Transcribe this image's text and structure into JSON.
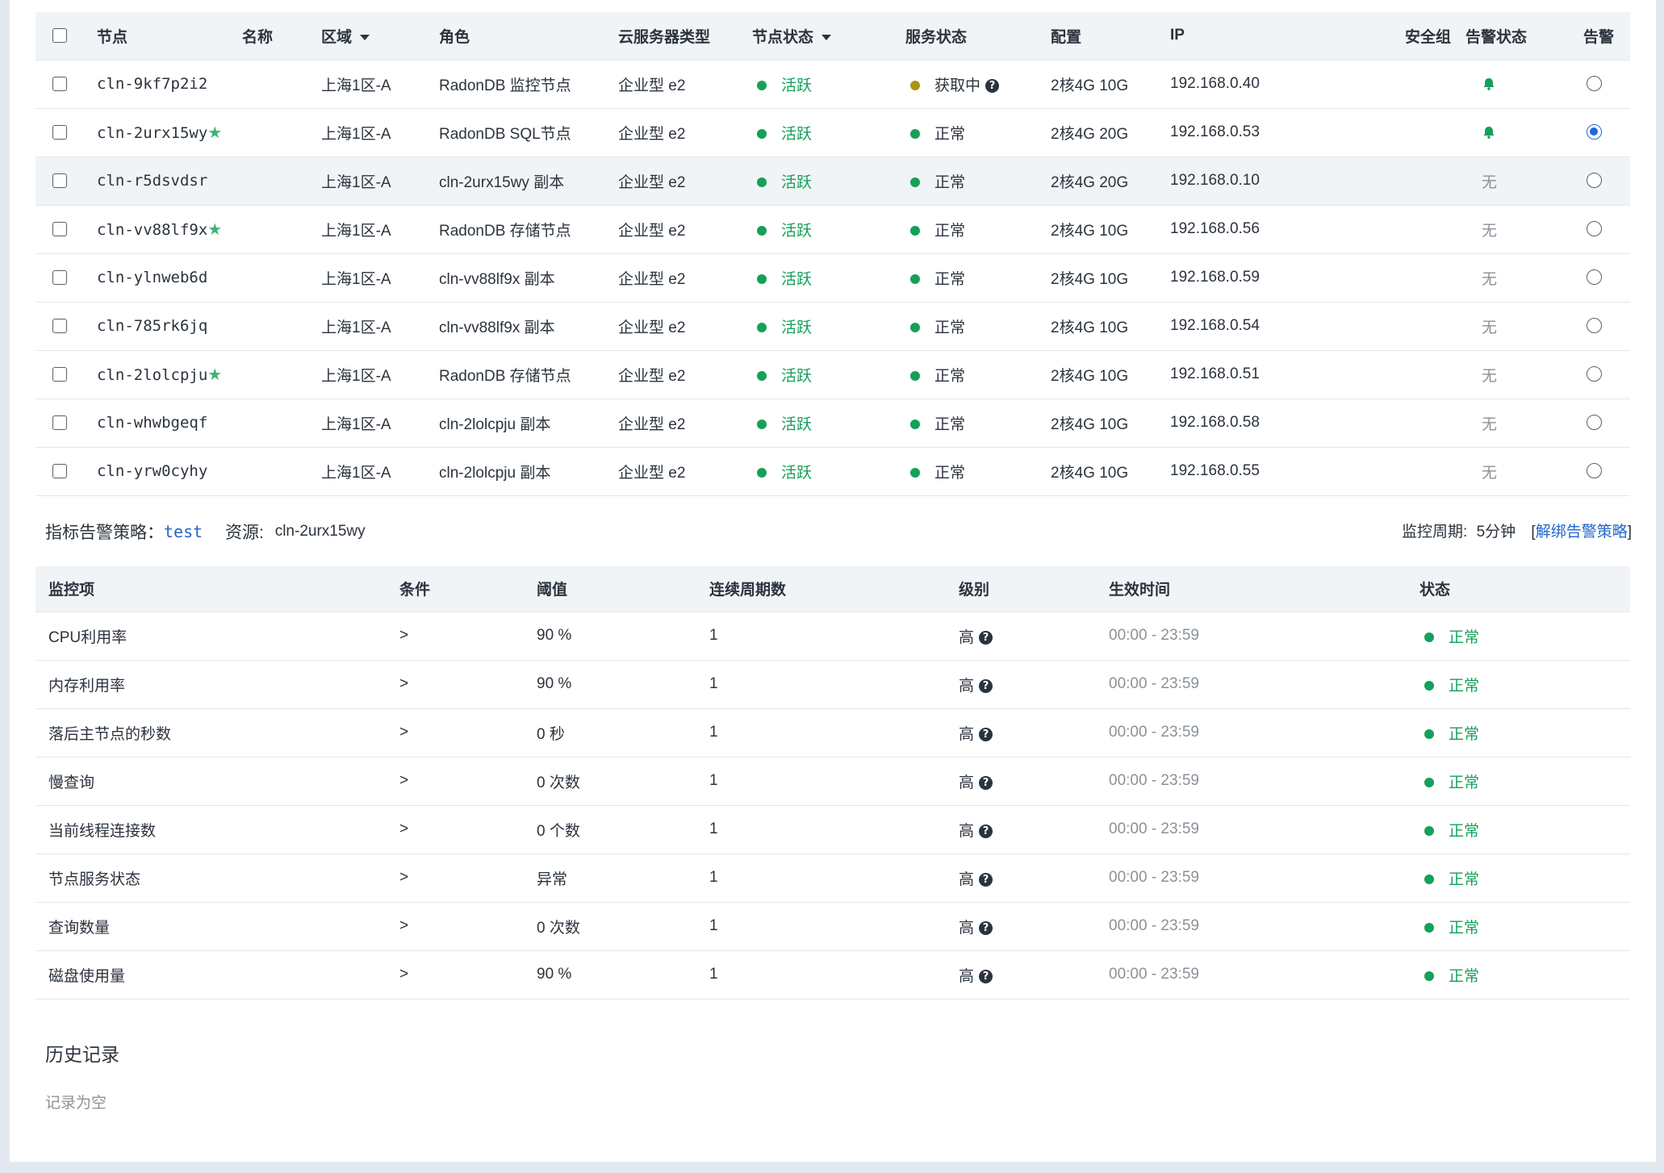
{
  "node_table": {
    "headers": {
      "node": "节点",
      "name": "名称",
      "zone": "区域",
      "role": "角色",
      "instance_type": "云服务器类型",
      "node_status": "节点状态",
      "service_status": "服务状态",
      "config": "配置",
      "ip": "IP",
      "security_group": "安全组",
      "alarm_status": "告警状态",
      "alarm": "告警"
    },
    "rows": [
      {
        "node": "cln-9kf7p2i2",
        "star": "",
        "zone": "上海1区-A",
        "role": "RadonDB 监控节点",
        "type": "企业型 e2",
        "node_status": "活跃",
        "service_status": "获取中",
        "service_color": "olive",
        "service_help": true,
        "config": "2核4G 10G",
        "ip": "192.168.0.40",
        "alarm_status": "bell",
        "alarm_selected": false
      },
      {
        "node": "cln-2urx15wy",
        "star": "★",
        "zone": "上海1区-A",
        "role": "RadonDB SQL节点",
        "type": "企业型 e2",
        "node_status": "活跃",
        "service_status": "正常",
        "service_color": "green",
        "service_help": false,
        "config": "2核4G 20G",
        "ip": "192.168.0.53",
        "alarm_status": "bell",
        "alarm_selected": true
      },
      {
        "node": "cln-r5dsvdsr",
        "star": "",
        "zone": "上海1区-A",
        "role": "cln-2urx15wy 副本",
        "type": "企业型 e2",
        "node_status": "活跃",
        "service_status": "正常",
        "service_color": "green",
        "service_help": false,
        "config": "2核4G 20G",
        "ip": "192.168.0.10",
        "alarm_status": "无",
        "alarm_selected": false,
        "highlight": true
      },
      {
        "node": "cln-vv88lf9x",
        "star": "★",
        "zone": "上海1区-A",
        "role": "RadonDB 存储节点",
        "type": "企业型 e2",
        "node_status": "活跃",
        "service_status": "正常",
        "service_color": "green",
        "service_help": false,
        "config": "2核4G 10G",
        "ip": "192.168.0.56",
        "alarm_status": "无",
        "alarm_selected": false
      },
      {
        "node": "cln-ylnweb6d",
        "star": "",
        "zone": "上海1区-A",
        "role": "cln-vv88lf9x 副本",
        "type": "企业型 e2",
        "node_status": "活跃",
        "service_status": "正常",
        "service_color": "green",
        "service_help": false,
        "config": "2核4G 10G",
        "ip": "192.168.0.59",
        "alarm_status": "无",
        "alarm_selected": false
      },
      {
        "node": "cln-785rk6jq",
        "star": "",
        "zone": "上海1区-A",
        "role": "cln-vv88lf9x 副本",
        "type": "企业型 e2",
        "node_status": "活跃",
        "service_status": "正常",
        "service_color": "green",
        "service_help": false,
        "config": "2核4G 10G",
        "ip": "192.168.0.54",
        "alarm_status": "无",
        "alarm_selected": false
      },
      {
        "node": "cln-2lolcpju",
        "star": "★",
        "zone": "上海1区-A",
        "role": "RadonDB 存储节点",
        "type": "企业型 e2",
        "node_status": "活跃",
        "service_status": "正常",
        "service_color": "green",
        "service_help": false,
        "config": "2核4G 10G",
        "ip": "192.168.0.51",
        "alarm_status": "无",
        "alarm_selected": false
      },
      {
        "node": "cln-whwbgeqf",
        "star": "",
        "zone": "上海1区-A",
        "role": "cln-2lolcpju 副本",
        "type": "企业型 e2",
        "node_status": "活跃",
        "service_status": "正常",
        "service_color": "green",
        "service_help": false,
        "config": "2核4G 10G",
        "ip": "192.168.0.58",
        "alarm_status": "无",
        "alarm_selected": false
      },
      {
        "node": "cln-yrw0cyhy",
        "star": "",
        "zone": "上海1区-A",
        "role": "cln-2lolcpju 副本",
        "type": "企业型 e2",
        "node_status": "活跃",
        "service_status": "正常",
        "service_color": "green",
        "service_help": false,
        "config": "2核4G 10G",
        "ip": "192.168.0.55",
        "alarm_status": "无",
        "alarm_selected": false
      }
    ]
  },
  "policy": {
    "label": "指标告警策略：",
    "name": "test",
    "resource_label": "资源:",
    "resource": "cln-2urx15wy",
    "period_label": "监控周期:",
    "period": "5分钟",
    "bracket_open": "[",
    "unbind": "解绑告警策略",
    "bracket_close": "]"
  },
  "metric_table": {
    "headers": {
      "item": "监控项",
      "condition": "条件",
      "threshold": "阈值",
      "periods": "连续周期数",
      "level": "级别",
      "time": "生效时间",
      "status": "状态"
    },
    "rows": [
      {
        "item": "CPU利用率",
        "condition": ">",
        "threshold": "90 %",
        "periods": "1",
        "level": "高",
        "time": "00:00 - 23:59",
        "status": "正常"
      },
      {
        "item": "内存利用率",
        "condition": ">",
        "threshold": "90 %",
        "periods": "1",
        "level": "高",
        "time": "00:00 - 23:59",
        "status": "正常"
      },
      {
        "item": "落后主节点的秒数",
        "condition": ">",
        "threshold": "0 秒",
        "periods": "1",
        "level": "高",
        "time": "00:00 - 23:59",
        "status": "正常"
      },
      {
        "item": "慢查询",
        "condition": ">",
        "threshold": "0 次数",
        "periods": "1",
        "level": "高",
        "time": "00:00 - 23:59",
        "status": "正常"
      },
      {
        "item": "当前线程连接数",
        "condition": ">",
        "threshold": "0 个数",
        "periods": "1",
        "level": "高",
        "time": "00:00 - 23:59",
        "status": "正常"
      },
      {
        "item": "节点服务状态",
        "condition": ">",
        "threshold": "异常",
        "periods": "1",
        "level": "高",
        "time": "00:00 - 23:59",
        "status": "正常"
      },
      {
        "item": "查询数量",
        "condition": ">",
        "threshold": "0 次数",
        "periods": "1",
        "level": "高",
        "time": "00:00 - 23:59",
        "status": "正常"
      },
      {
        "item": "磁盘使用量",
        "condition": ">",
        "threshold": "90 %",
        "periods": "1",
        "level": "高",
        "time": "00:00 - 23:59",
        "status": "正常"
      }
    ]
  },
  "history": {
    "title": "历史记录",
    "empty": "记录为空"
  },
  "colors": {
    "active_green": "#15a05a",
    "fetching_olive": "#b09114",
    "link_blue": "#2266cc",
    "radio_blue": "#2266dd",
    "header_bg": "#f1f4f7"
  }
}
